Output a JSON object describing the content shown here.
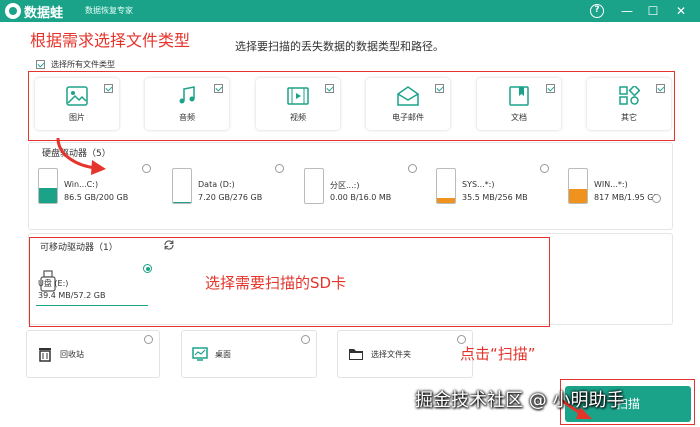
{
  "titlebar": {
    "app_name": "数据蛙",
    "subtitle": "数据恢复专家",
    "help": "?",
    "minimize": "—",
    "maximize": "☐",
    "close": "✕"
  },
  "annotations": {
    "select_types": "根据需求选择文件类型",
    "select_sd": "选择需要扫描的SD卡",
    "click_scan": "点击“扫描”"
  },
  "instruction": "选择要扫描的丢失数据的数据类型和路径。",
  "select_all": {
    "label": "选择所有文件类型",
    "checked": true
  },
  "file_types": [
    {
      "label": "图片",
      "icon": "image-icon",
      "checked": true
    },
    {
      "label": "音频",
      "icon": "music-icon",
      "checked": true
    },
    {
      "label": "视频",
      "icon": "video-icon",
      "checked": true
    },
    {
      "label": "电子邮件",
      "icon": "email-icon",
      "checked": true
    },
    {
      "label": "文档",
      "icon": "document-icon",
      "checked": true
    },
    {
      "label": "其它",
      "icon": "grid-icon",
      "checked": true
    }
  ],
  "hard_drives": {
    "title": "硬盘驱动器（5）",
    "items": [
      {
        "name": "Win...C:)",
        "size": "86.5 GB/200 GB",
        "used": 0.43,
        "color": "#1ba38a"
      },
      {
        "name": "Data (D:)",
        "size": "7.20 GB/276 GB",
        "used": 0.03,
        "color": "#1ba38a"
      },
      {
        "name": "分区...:)",
        "size": "0.00  B/16.0 MB",
        "used": 0.0,
        "color": "#1ba38a"
      },
      {
        "name": "SYS...*:)",
        "size": "35.5 MB/256 MB",
        "used": 0.14,
        "color": "#f0921e"
      },
      {
        "name": "WIN...*:)",
        "size": "817 MB/1.95 GB",
        "used": 0.42,
        "color": "#f0921e"
      }
    ]
  },
  "removable": {
    "title": "可移动驱动器（1）",
    "refresh_icon": "refresh-icon",
    "items": [
      {
        "name": "U盘 (E:)",
        "size": "39.4 MB/57.2 GB",
        "selected": true
      }
    ]
  },
  "locations": [
    {
      "label": "回收站",
      "icon": "trash-icon"
    },
    {
      "label": "桌面",
      "icon": "desktop-icon"
    },
    {
      "label": "选择文件夹",
      "icon": "folder-icon"
    }
  ],
  "scan_button": "扫描",
  "watermark": "掘金技术社区 @ 小明助手",
  "colors": {
    "brand": "#1ba38a",
    "annotation_red": "#e5342b",
    "system_drive": "#f0921e"
  }
}
